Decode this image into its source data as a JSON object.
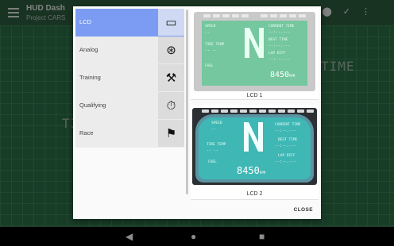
{
  "app": {
    "title": "HUD Dash",
    "subtitle": "Project CARS",
    "action_icons": [
      "save-icon",
      "pin-icon",
      "check-icon",
      "overflow-icon"
    ]
  },
  "background": {
    "labels": [
      "TIRE",
      "TIME"
    ]
  },
  "dialog": {
    "items": [
      {
        "label": "LCD",
        "icon": "rectangle-icon",
        "glyph": "▭"
      },
      {
        "label": "Analog",
        "icon": "gauge-icon",
        "glyph": "⊛"
      },
      {
        "label": "Training",
        "icon": "tools-icon",
        "glyph": "⚒"
      },
      {
        "label": "Qualifying",
        "icon": "stopwatch-icon",
        "glyph": "⏱"
      },
      {
        "label": "Race",
        "icon": "checkered-flag-icon",
        "glyph": "⚑"
      }
    ],
    "selected_index": 0,
    "previews": [
      {
        "caption": "LCD 1"
      },
      {
        "caption": "LCD 2"
      }
    ],
    "close_label": "CLOSE"
  },
  "lcd": {
    "speed_label": "SPEED",
    "current_time_label": "CURRENT TIME",
    "best_time_label": "BEST TIME",
    "tire_temp_label": "TIRE TEMP",
    "lap_diff_label": "LAP DIFF",
    "fuel_label": "FUEL",
    "gear": "N",
    "rpm": "8450",
    "rpm_unit": "RPM",
    "dashes_short": "--",
    "dashes_time": "--:--.---",
    "dashes_tire": "-- --"
  },
  "colors": {
    "selected": "#7b9cf2",
    "lcd1_screen": "#74c79f",
    "lcd2_screen": "#3fb7b5",
    "grid": "#2d6f47"
  }
}
